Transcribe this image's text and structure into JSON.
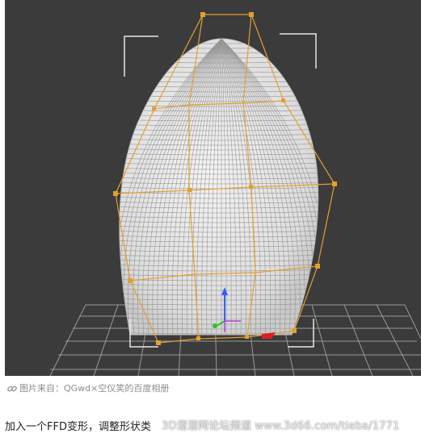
{
  "image_credit": "图片来自：QGwd×空仪笑的百度相册",
  "body_text": "加入一个FFD变形，调整形状类",
  "watermark": "3D溜溜网论坛频道 www.3d66.com/tieba/1771",
  "colors": {
    "viewport_bg": "#3b3b3b",
    "lattice": "#e2a030",
    "mesh": "#ececec",
    "grid": "#9a9a9a"
  },
  "icons": {
    "credit": "link-icon"
  }
}
